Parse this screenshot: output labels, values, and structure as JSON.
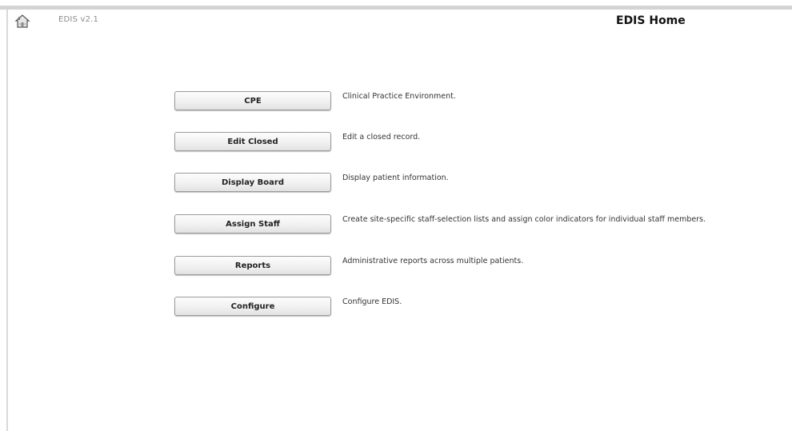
{
  "app": {
    "version": "EDIS v2.1",
    "title": "EDIS Home"
  },
  "icons": {
    "home": "home-icon"
  },
  "menu": [
    {
      "label": "CPE",
      "description": "Clinical Practice Environment."
    },
    {
      "label": "Edit Closed",
      "description": "Edit a closed record."
    },
    {
      "label": "Display Board",
      "description": "Display patient information."
    },
    {
      "label": "Assign Staff",
      "description": "Create site-specific staff-selection lists and assign color indicators for individual staff members."
    },
    {
      "label": "Reports",
      "description": "Administrative reports across multiple patients."
    },
    {
      "label": "Configure",
      "description": "Configure EDIS."
    }
  ]
}
